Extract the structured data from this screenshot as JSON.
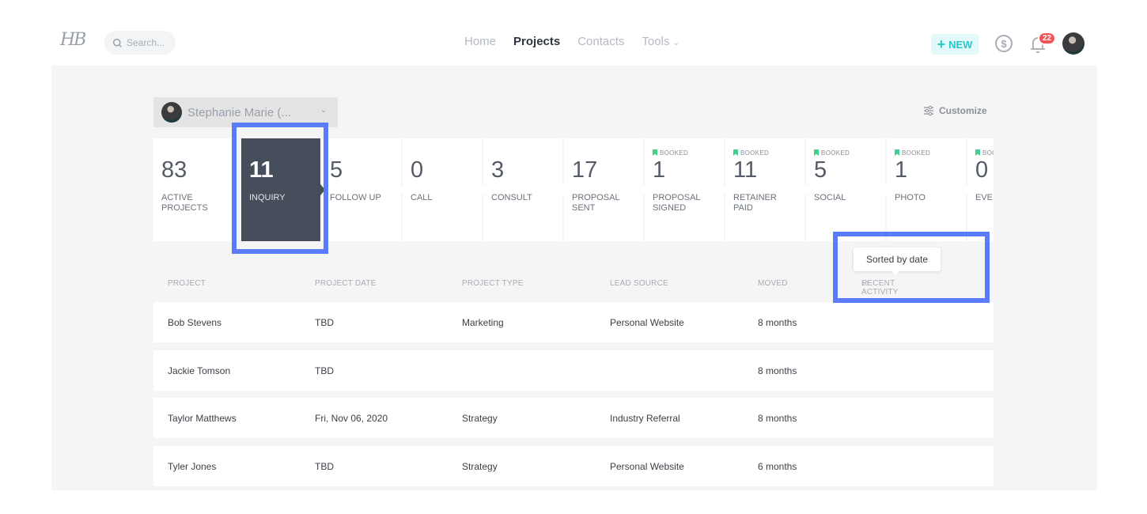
{
  "header": {
    "logo": "HB",
    "search_placeholder": "Search...",
    "nav": [
      {
        "label": "Home",
        "active": false
      },
      {
        "label": "Projects",
        "active": true
      },
      {
        "label": "Contacts",
        "active": false
      },
      {
        "label": "Tools",
        "active": false,
        "has_dropdown": true
      }
    ],
    "new_button": "NEW",
    "new_button_icon": "plus-icon",
    "payments_icon": "dollar-icon",
    "notifications_icon": "bell-icon",
    "notification_count": "22",
    "avatar": "user-avatar"
  },
  "toolbar": {
    "user_filter": "Stephanie Marie (...",
    "customize_label": "Customize",
    "customize_icon": "sliders-icon"
  },
  "stages": [
    {
      "count": "83",
      "label": "ACTIVE PROJECTS",
      "booked": false,
      "active": false
    },
    {
      "count": "11",
      "label": "INQUIRY",
      "booked": false,
      "active": true
    },
    {
      "count": "5",
      "label": "FOLLOW UP",
      "booked": false,
      "active": false
    },
    {
      "count": "0",
      "label": "CALL",
      "booked": false,
      "active": false
    },
    {
      "count": "3",
      "label": "CONSULT",
      "booked": false,
      "active": false
    },
    {
      "count": "17",
      "label": "PROPOSAL SENT",
      "booked": false,
      "active": false
    },
    {
      "count": "1",
      "label": "PROPOSAL SIGNED",
      "booked": true,
      "active": false
    },
    {
      "count": "11",
      "label": "RETAINER PAID",
      "booked": true,
      "active": false
    },
    {
      "count": "5",
      "label": "SOCIAL",
      "booked": true,
      "active": false
    },
    {
      "count": "1",
      "label": "PHOTO",
      "booked": true,
      "active": false
    },
    {
      "count": "0",
      "label": "EVE",
      "booked": true,
      "active": false
    }
  ],
  "booked_label": "BOOKED",
  "tooltip": "Sorted by date",
  "table": {
    "columns": [
      "PROJECT",
      "PROJECT DATE",
      "PROJECT TYPE",
      "LEAD SOURCE",
      "MOVED",
      "RECENT ACTIVITY"
    ],
    "sort_icon": "↓↑",
    "rows": [
      [
        "Bob Stevens",
        "TBD",
        "Marketing",
        "Personal Website",
        "8 months",
        ""
      ],
      [
        "Jackie Tomson",
        "TBD",
        "",
        "",
        "8 months",
        ""
      ],
      [
        "Taylor Matthews",
        "Fri, Nov 06, 2020",
        "Strategy",
        "Industry Referral",
        "8 months",
        ""
      ],
      [
        "Tyler Jones",
        "TBD",
        "Strategy",
        "Personal Website",
        "6 months",
        ""
      ]
    ]
  },
  "colors": {
    "accent_highlight": "#5b7cfa",
    "active_stage": "#464e5b",
    "booked_green": "#3ed08c",
    "new_button_teal": "#2cc5c9",
    "badge_red": "#f05454"
  }
}
